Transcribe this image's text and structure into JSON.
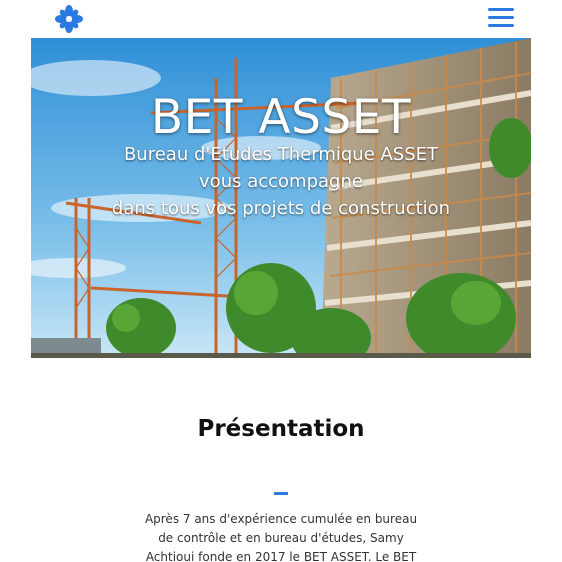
{
  "header": {
    "logo_icon": "flower-logo-icon",
    "menu_icon": "hamburger-menu-icon",
    "accent_color": "#2a7ae2"
  },
  "hero": {
    "title": "BET ASSET",
    "subtitle_lines": [
      "Bureau d'Etudes Thermique ASSET",
      "vous accompagne",
      "dans tous vos projets de construction"
    ]
  },
  "presentation": {
    "title": "Présentation",
    "text_lines": [
      "Après 7 ans d'expérience cumulée en bureau",
      "de contrôle et en bureau d'études, Samy",
      "Achtioui fonde en 2017 le BET ASSET. Le BET"
    ]
  }
}
